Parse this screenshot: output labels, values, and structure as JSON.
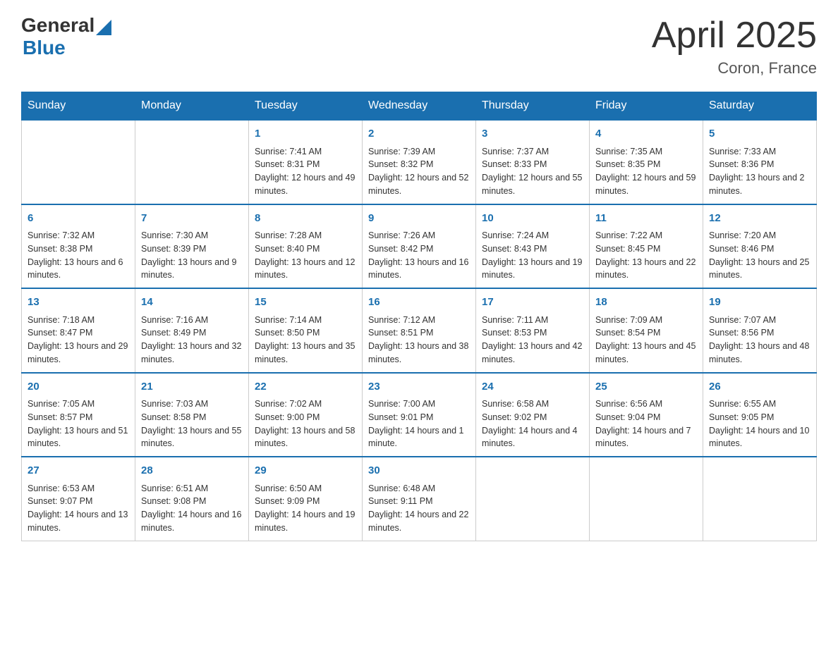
{
  "logo": {
    "general": "General",
    "blue": "Blue"
  },
  "title": "April 2025",
  "subtitle": "Coron, France",
  "days": [
    "Sunday",
    "Monday",
    "Tuesday",
    "Wednesday",
    "Thursday",
    "Friday",
    "Saturday"
  ],
  "weeks": [
    [
      {
        "num": "",
        "sunrise": "",
        "sunset": "",
        "daylight": ""
      },
      {
        "num": "",
        "sunrise": "",
        "sunset": "",
        "daylight": ""
      },
      {
        "num": "1",
        "sunrise": "Sunrise: 7:41 AM",
        "sunset": "Sunset: 8:31 PM",
        "daylight": "Daylight: 12 hours and 49 minutes."
      },
      {
        "num": "2",
        "sunrise": "Sunrise: 7:39 AM",
        "sunset": "Sunset: 8:32 PM",
        "daylight": "Daylight: 12 hours and 52 minutes."
      },
      {
        "num": "3",
        "sunrise": "Sunrise: 7:37 AM",
        "sunset": "Sunset: 8:33 PM",
        "daylight": "Daylight: 12 hours and 55 minutes."
      },
      {
        "num": "4",
        "sunrise": "Sunrise: 7:35 AM",
        "sunset": "Sunset: 8:35 PM",
        "daylight": "Daylight: 12 hours and 59 minutes."
      },
      {
        "num": "5",
        "sunrise": "Sunrise: 7:33 AM",
        "sunset": "Sunset: 8:36 PM",
        "daylight": "Daylight: 13 hours and 2 minutes."
      }
    ],
    [
      {
        "num": "6",
        "sunrise": "Sunrise: 7:32 AM",
        "sunset": "Sunset: 8:38 PM",
        "daylight": "Daylight: 13 hours and 6 minutes."
      },
      {
        "num": "7",
        "sunrise": "Sunrise: 7:30 AM",
        "sunset": "Sunset: 8:39 PM",
        "daylight": "Daylight: 13 hours and 9 minutes."
      },
      {
        "num": "8",
        "sunrise": "Sunrise: 7:28 AM",
        "sunset": "Sunset: 8:40 PM",
        "daylight": "Daylight: 13 hours and 12 minutes."
      },
      {
        "num": "9",
        "sunrise": "Sunrise: 7:26 AM",
        "sunset": "Sunset: 8:42 PM",
        "daylight": "Daylight: 13 hours and 16 minutes."
      },
      {
        "num": "10",
        "sunrise": "Sunrise: 7:24 AM",
        "sunset": "Sunset: 8:43 PM",
        "daylight": "Daylight: 13 hours and 19 minutes."
      },
      {
        "num": "11",
        "sunrise": "Sunrise: 7:22 AM",
        "sunset": "Sunset: 8:45 PM",
        "daylight": "Daylight: 13 hours and 22 minutes."
      },
      {
        "num": "12",
        "sunrise": "Sunrise: 7:20 AM",
        "sunset": "Sunset: 8:46 PM",
        "daylight": "Daylight: 13 hours and 25 minutes."
      }
    ],
    [
      {
        "num": "13",
        "sunrise": "Sunrise: 7:18 AM",
        "sunset": "Sunset: 8:47 PM",
        "daylight": "Daylight: 13 hours and 29 minutes."
      },
      {
        "num": "14",
        "sunrise": "Sunrise: 7:16 AM",
        "sunset": "Sunset: 8:49 PM",
        "daylight": "Daylight: 13 hours and 32 minutes."
      },
      {
        "num": "15",
        "sunrise": "Sunrise: 7:14 AM",
        "sunset": "Sunset: 8:50 PM",
        "daylight": "Daylight: 13 hours and 35 minutes."
      },
      {
        "num": "16",
        "sunrise": "Sunrise: 7:12 AM",
        "sunset": "Sunset: 8:51 PM",
        "daylight": "Daylight: 13 hours and 38 minutes."
      },
      {
        "num": "17",
        "sunrise": "Sunrise: 7:11 AM",
        "sunset": "Sunset: 8:53 PM",
        "daylight": "Daylight: 13 hours and 42 minutes."
      },
      {
        "num": "18",
        "sunrise": "Sunrise: 7:09 AM",
        "sunset": "Sunset: 8:54 PM",
        "daylight": "Daylight: 13 hours and 45 minutes."
      },
      {
        "num": "19",
        "sunrise": "Sunrise: 7:07 AM",
        "sunset": "Sunset: 8:56 PM",
        "daylight": "Daylight: 13 hours and 48 minutes."
      }
    ],
    [
      {
        "num": "20",
        "sunrise": "Sunrise: 7:05 AM",
        "sunset": "Sunset: 8:57 PM",
        "daylight": "Daylight: 13 hours and 51 minutes."
      },
      {
        "num": "21",
        "sunrise": "Sunrise: 7:03 AM",
        "sunset": "Sunset: 8:58 PM",
        "daylight": "Daylight: 13 hours and 55 minutes."
      },
      {
        "num": "22",
        "sunrise": "Sunrise: 7:02 AM",
        "sunset": "Sunset: 9:00 PM",
        "daylight": "Daylight: 13 hours and 58 minutes."
      },
      {
        "num": "23",
        "sunrise": "Sunrise: 7:00 AM",
        "sunset": "Sunset: 9:01 PM",
        "daylight": "Daylight: 14 hours and 1 minute."
      },
      {
        "num": "24",
        "sunrise": "Sunrise: 6:58 AM",
        "sunset": "Sunset: 9:02 PM",
        "daylight": "Daylight: 14 hours and 4 minutes."
      },
      {
        "num": "25",
        "sunrise": "Sunrise: 6:56 AM",
        "sunset": "Sunset: 9:04 PM",
        "daylight": "Daylight: 14 hours and 7 minutes."
      },
      {
        "num": "26",
        "sunrise": "Sunrise: 6:55 AM",
        "sunset": "Sunset: 9:05 PM",
        "daylight": "Daylight: 14 hours and 10 minutes."
      }
    ],
    [
      {
        "num": "27",
        "sunrise": "Sunrise: 6:53 AM",
        "sunset": "Sunset: 9:07 PM",
        "daylight": "Daylight: 14 hours and 13 minutes."
      },
      {
        "num": "28",
        "sunrise": "Sunrise: 6:51 AM",
        "sunset": "Sunset: 9:08 PM",
        "daylight": "Daylight: 14 hours and 16 minutes."
      },
      {
        "num": "29",
        "sunrise": "Sunrise: 6:50 AM",
        "sunset": "Sunset: 9:09 PM",
        "daylight": "Daylight: 14 hours and 19 minutes."
      },
      {
        "num": "30",
        "sunrise": "Sunrise: 6:48 AM",
        "sunset": "Sunset: 9:11 PM",
        "daylight": "Daylight: 14 hours and 22 minutes."
      },
      {
        "num": "",
        "sunrise": "",
        "sunset": "",
        "daylight": ""
      },
      {
        "num": "",
        "sunrise": "",
        "sunset": "",
        "daylight": ""
      },
      {
        "num": "",
        "sunrise": "",
        "sunset": "",
        "daylight": ""
      }
    ]
  ]
}
